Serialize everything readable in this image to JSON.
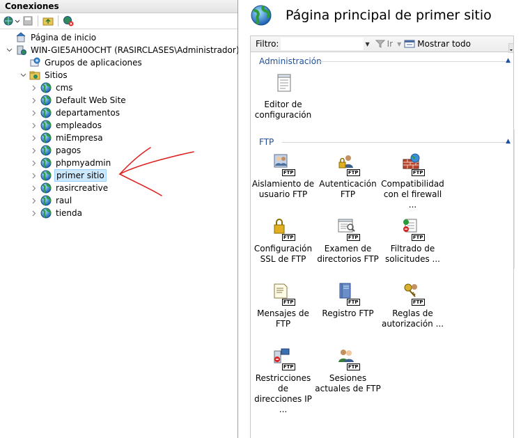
{
  "left": {
    "header": "Conexiones",
    "tree": [
      {
        "label": "Página de inicio",
        "indent": 0,
        "icon": "home-server-icon",
        "expander": ""
      },
      {
        "label": "WIN-GIE5AH0OCHT (RASIRCLASES\\Administrador)",
        "indent": 0,
        "icon": "server-icon",
        "expander": "v"
      },
      {
        "label": "Grupos de aplicaciones",
        "indent": 1,
        "icon": "app-pool-icon",
        "expander": ""
      },
      {
        "label": "Sitios",
        "indent": 1,
        "icon": "sites-folder-icon",
        "expander": "v"
      },
      {
        "label": "cms",
        "indent": 2,
        "icon": "globe-icon",
        "expander": ">"
      },
      {
        "label": "Default Web Site",
        "indent": 2,
        "icon": "globe-icon",
        "expander": ">"
      },
      {
        "label": "departamentos",
        "indent": 2,
        "icon": "globe-icon",
        "expander": ">"
      },
      {
        "label": "empleados",
        "indent": 2,
        "icon": "globe-icon",
        "expander": ">"
      },
      {
        "label": "miEmpresa",
        "indent": 2,
        "icon": "globe-icon",
        "expander": ">"
      },
      {
        "label": "pagos",
        "indent": 2,
        "icon": "globe-icon",
        "expander": ">"
      },
      {
        "label": "phpmyadmin",
        "indent": 2,
        "icon": "globe-icon",
        "expander": ">"
      },
      {
        "label": "primer sitio",
        "indent": 2,
        "icon": "globe-icon",
        "expander": ">",
        "selected": true
      },
      {
        "label": "rasircreative",
        "indent": 2,
        "icon": "globe-icon",
        "expander": ">"
      },
      {
        "label": "raul",
        "indent": 2,
        "icon": "globe-icon",
        "expander": ">"
      },
      {
        "label": "tienda",
        "indent": 2,
        "icon": "globe-icon",
        "expander": ">"
      }
    ]
  },
  "right": {
    "title": "Página principal de primer sitio",
    "filter": {
      "label": "Filtro:",
      "value": "",
      "go_label": "Ir",
      "show_all_label": "Mostrar todo"
    },
    "groups": {
      "admin": {
        "name": "Administración",
        "features": [
          {
            "label1": "Editor de",
            "label2": "configuración",
            "icon": "config-editor-icon"
          }
        ]
      },
      "ftp": {
        "name": "FTP",
        "badge": "FTP",
        "features": [
          {
            "label1": "Aislamiento de",
            "label2": "usuario FTP",
            "icon": "ftp-user-isolation-icon"
          },
          {
            "label1": "Autenticación",
            "label2": "FTP",
            "icon": "ftp-authentication-icon"
          },
          {
            "label1": "Compatibilidad",
            "label2": "con el firewall ...",
            "icon": "ftp-firewall-icon"
          },
          {
            "label1": "Configuración",
            "label2": "SSL de FTP",
            "icon": "ftp-ssl-icon"
          },
          {
            "label1": "Examen de",
            "label2": "directorios FTP",
            "icon": "ftp-directory-browsing-icon"
          },
          {
            "label1": "Filtrado de",
            "label2": "solicitudes ...",
            "icon": "ftp-request-filtering-icon"
          },
          {
            "label1": "Mensajes de FTP",
            "label2": "",
            "icon": "ftp-messages-icon"
          },
          {
            "label1": "Registro FTP",
            "label2": "",
            "icon": "ftp-logging-icon"
          },
          {
            "label1": "Reglas de",
            "label2": "autorización ...",
            "icon": "ftp-authorization-icon"
          },
          {
            "label1": "Restricciones de",
            "label2": "direcciones IP ...",
            "icon": "ftp-ip-restrictions-icon"
          },
          {
            "label1": "Sesiones",
            "label2": "actuales de FTP",
            "icon": "ftp-sessions-icon"
          }
        ]
      }
    }
  },
  "colors": {
    "group_header": "#1e4f9c",
    "selection": "#cce8ff",
    "annotation": "#e02020"
  }
}
